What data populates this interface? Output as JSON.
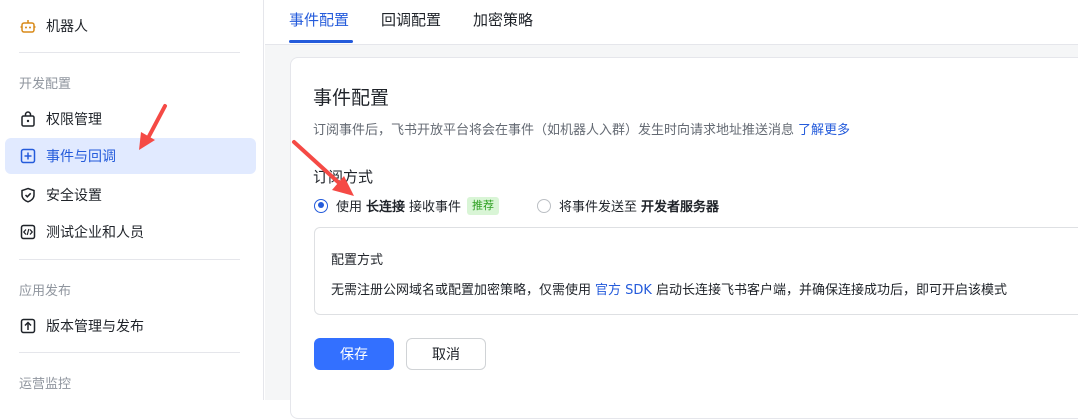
{
  "sidebar": {
    "bot_label": "机器人",
    "sections": [
      {
        "label": "开发配置"
      },
      {
        "label": "应用发布"
      },
      {
        "label": "运营监控"
      }
    ],
    "items": [
      {
        "label": "权限管理",
        "icon": "lock-icon"
      },
      {
        "label": "事件与回调",
        "icon": "event-icon",
        "active": true
      },
      {
        "label": "安全设置",
        "icon": "shield-icon"
      },
      {
        "label": "测试企业和人员",
        "icon": "code-icon"
      },
      {
        "label": "版本管理与发布",
        "icon": "upload-icon"
      }
    ]
  },
  "tabs": [
    {
      "label": "事件配置",
      "active": true
    },
    {
      "label": "回调配置"
    },
    {
      "label": "加密策略"
    }
  ],
  "main": {
    "title": "事件配置",
    "description": "订阅事件后，飞书开放平台将会在事件（如机器人入群）发生时向请求地址推送消息",
    "learn_more": "了解更多",
    "subscribe_label": "订阅方式",
    "option1": {
      "prefix": "使用",
      "bold": "长连接",
      "suffix": "接收事件",
      "tag": "推荐",
      "checked": true
    },
    "option2": {
      "prefix": "将事件发送至",
      "bold": "开发者服务器",
      "checked": false
    },
    "config": {
      "title": "配置方式",
      "desc_prefix": "无需注册公网域名或配置加密策略，仅需使用",
      "desc_link": "官方 SDK",
      "desc_suffix": "启动长连接飞书客户端，并确保连接成功后，即可开启该模式"
    },
    "save_label": "保存",
    "cancel_label": "取消"
  },
  "colors": {
    "accent": "#245bdb",
    "primary_button": "#3370ff",
    "active_bg": "#e1eaff",
    "arrow": "#f54a45"
  }
}
